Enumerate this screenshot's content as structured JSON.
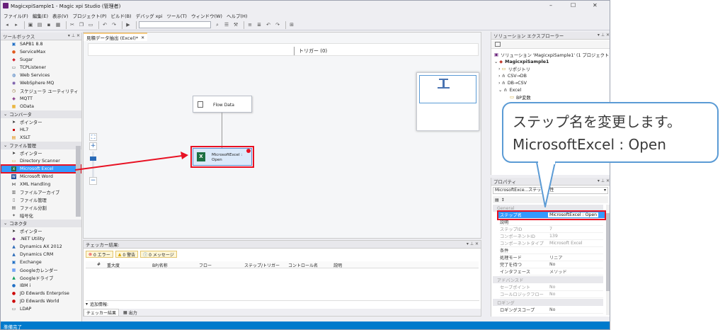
{
  "window": {
    "title": "MagicxpiSample1 - Magic xpi Studio (管理者)",
    "controls": [
      "–",
      "☐",
      "✕"
    ]
  },
  "menu": [
    "ファイル(F)",
    "編集(E)",
    "表示(V)",
    "プロジェクト(P)",
    "ビルド(B)",
    "デバッグ xpi",
    "ツール(T)",
    "ウィンドウ(W)",
    "ヘルプ(H)"
  ],
  "toolbox": {
    "header": "ツールボックス",
    "items_top": [
      "SAPB1 8.8",
      "ServiceMax",
      "Sugar",
      "TCPListener",
      "Web Services",
      "WebSphere MQ",
      "スケジューラ ユーティリティ",
      "MQTT",
      "OData"
    ],
    "cat_converter": "コンバータ",
    "items_converter": [
      "ポインター",
      "HL7",
      "XSLT"
    ],
    "cat_file": "ファイル管理",
    "items_file": [
      "ポインター",
      "Directory Scanner",
      "Microsoft Excel",
      "Microsoft Word",
      "XML Handling",
      "ファイルアーカイブ",
      "ファイル管理",
      "ファイル分割",
      "暗号化"
    ],
    "cat_connector": "コネクタ",
    "items_connector": [
      "ポインター",
      ".NET Utility",
      "Dynamics AX 2012",
      "Dynamics CRM",
      "Exchange",
      "Googleカレンダー",
      "Googleドライブ",
      "IBM i",
      "JD Edwards Enterprise",
      "JD Edwards World",
      "LDAP"
    ]
  },
  "designer": {
    "tab": "見積データ抽出 (Excel)*",
    "trigger": "トリガー (0)",
    "node_flow": "Flow Data",
    "node_excel": "MicrosoftExcel : Open"
  },
  "checker": {
    "header": "チェッカー結果:",
    "errors": "0 エラー",
    "warnings": "0 警告",
    "messages": "0 メッセージ",
    "columns": [
      "#",
      "重大度",
      "BP/名称",
      "フロー",
      "ステップ/トリガー",
      "コントロール名",
      "説明"
    ],
    "more": "追加情報:",
    "tab_checker": "チェッカー結果",
    "tab_output": "出力"
  },
  "solution": {
    "header": "ソリューション エクスプローラー",
    "root": "ソリューション 'MagicxpiSample1' (1 プロジェクト)",
    "project": "MagicxpiSample1",
    "items": [
      "リポジトリ",
      "CSV→DB",
      "DB→CSV",
      "Excel"
    ],
    "subitem": "BP変数"
  },
  "properties": {
    "header": "プロパティ",
    "combo": "MicrosoftExce...ステップ特性",
    "cat_general": "General",
    "rows_general": [
      {
        "k": "ステップ名",
        "v": "MicrosoftExcel : Open"
      },
      {
        "k": "説明",
        "v": ""
      },
      {
        "k": "ステップID",
        "v": "7"
      },
      {
        "k": "コンポーネントID",
        "v": "139"
      },
      {
        "k": "コンポーネントタイプ",
        "v": "Microsoft Excel"
      },
      {
        "k": "条件",
        "v": ""
      },
      {
        "k": "処理モード",
        "v": "リニア"
      },
      {
        "k": "完了を待つ",
        "v": "No"
      },
      {
        "k": "インタフェース",
        "v": "メソッド"
      }
    ],
    "cat_advanced": "アドバンスド",
    "rows_advanced": [
      {
        "k": "セーブポイント",
        "v": "No"
      },
      {
        "k": "コールロジックフロー",
        "v": "No"
      }
    ],
    "cat_logging": "ロギング",
    "rows_logging": [
      {
        "k": "ロギングスコープ",
        "v": "No"
      }
    ]
  },
  "status": "準備完了",
  "callout": {
    "line1": "ステップ名を変更します。",
    "line2": "MicrosoftExcel : Open"
  },
  "colors": {
    "highlight": "#e81123",
    "callout_border": "#5b9bd5",
    "status_bar": "#007acc",
    "selection": "#3399ff"
  }
}
